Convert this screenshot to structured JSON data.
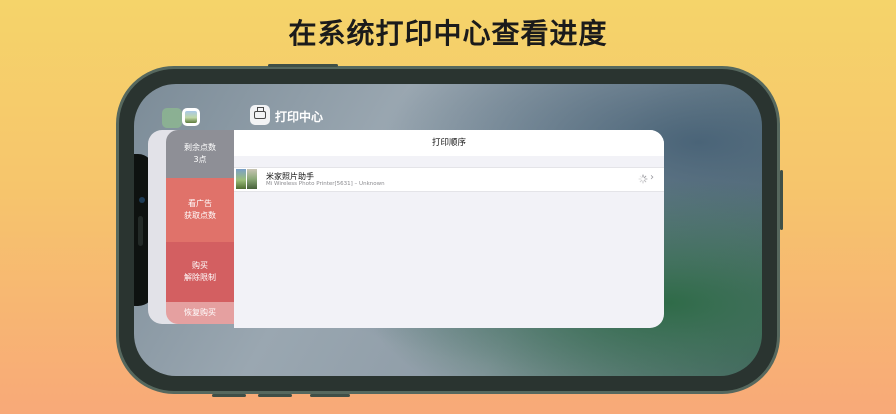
{
  "headline": "在系统打印中心查看进度",
  "app_header": {
    "title": "打印中心",
    "icon": "printer-icon"
  },
  "menu": {
    "items": [
      {
        "line1": "剩余点数",
        "line2": "3点"
      },
      {
        "line1": "看广告",
        "line2": "获取点数"
      },
      {
        "line1": "购买",
        "line2": "解除限制"
      },
      {
        "line1": "恢复购买",
        "line2": ""
      }
    ]
  },
  "print_queue": {
    "title": "打印顺序",
    "jobs": [
      {
        "name": "米家照片助手",
        "detail": "Mi Wireless Photo Printer[5631] – Unknown",
        "status": "spinner-icon"
      }
    ]
  },
  "colors": {
    "background_top": "#f5d46a",
    "background_bottom": "#f8a978",
    "menu_gray": "#8e8f96",
    "menu_red": "#e0726a",
    "menu_red_dark": "#d35f61"
  }
}
